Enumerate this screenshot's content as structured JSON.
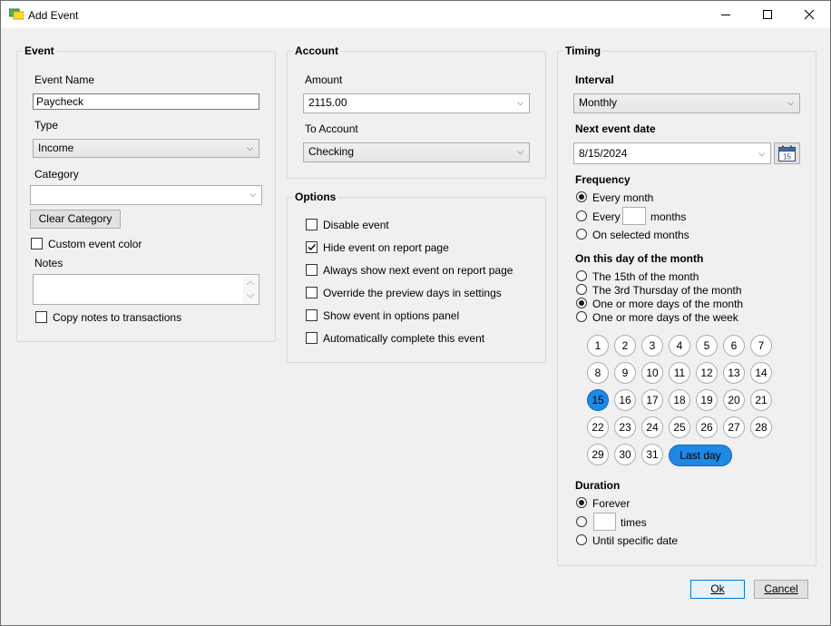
{
  "window": {
    "title": "Add Event"
  },
  "event": {
    "group_label": "Event",
    "name_label": "Event Name",
    "name_value": "Paycheck",
    "type_label": "Type",
    "type_value": "Income",
    "category_label": "Category",
    "category_value": "",
    "clear_category_label": "Clear Category",
    "custom_color_label": "Custom event color",
    "custom_color_checked": false,
    "notes_label": "Notes",
    "notes_value": "",
    "copy_notes_label": "Copy notes to transactions",
    "copy_notes_checked": false
  },
  "account": {
    "group_label": "Account",
    "amount_label": "Amount",
    "amount_value": "2115.00",
    "to_account_label": "To Account",
    "to_account_value": "Checking"
  },
  "options": {
    "group_label": "Options",
    "items": [
      {
        "label": "Disable event",
        "checked": false
      },
      {
        "label": "Hide event on report page",
        "checked": true
      },
      {
        "label": "Always show next event on report page",
        "checked": false
      },
      {
        "label": "Override the preview days in settings",
        "checked": false
      },
      {
        "label": "Show event in options panel",
        "checked": false
      },
      {
        "label": "Automatically complete this event",
        "checked": false
      }
    ]
  },
  "timing": {
    "group_label": "Timing",
    "interval_label": "Interval",
    "interval_value": "Monthly",
    "next_date_label": "Next event date",
    "next_date_value": "8/15/2024",
    "calendar_icon_day": "15",
    "frequency_label": "Frequency",
    "frequency_every_month": "Every month",
    "frequency_every": "Every",
    "frequency_months": "months",
    "frequency_every_value": "",
    "frequency_selected": "On selected months",
    "frequency_choice": "every_month",
    "day_of_month_label": "On this day of the month",
    "dom_15th": "The 15th of the month",
    "dom_3rd_thursday": "The 3rd Thursday of the month",
    "dom_days_of_month": "One or more days of the month",
    "dom_days_of_week": "One or more days of the week",
    "dom_choice": "days_of_month",
    "days": [
      "1",
      "2",
      "3",
      "4",
      "5",
      "6",
      "7",
      "8",
      "9",
      "10",
      "11",
      "12",
      "13",
      "14",
      "15",
      "16",
      "17",
      "18",
      "19",
      "20",
      "21",
      "22",
      "23",
      "24",
      "25",
      "26",
      "27",
      "28",
      "29",
      "30",
      "31"
    ],
    "selected_days": [
      "15"
    ],
    "last_day_label": "Last day",
    "last_day_selected": true,
    "duration_label": "Duration",
    "duration_forever": "Forever",
    "duration_times": "times",
    "duration_times_value": "",
    "duration_until": "Until specific date",
    "duration_choice": "forever"
  },
  "footer": {
    "ok_label": "Ok",
    "cancel_label": "Cancel"
  }
}
